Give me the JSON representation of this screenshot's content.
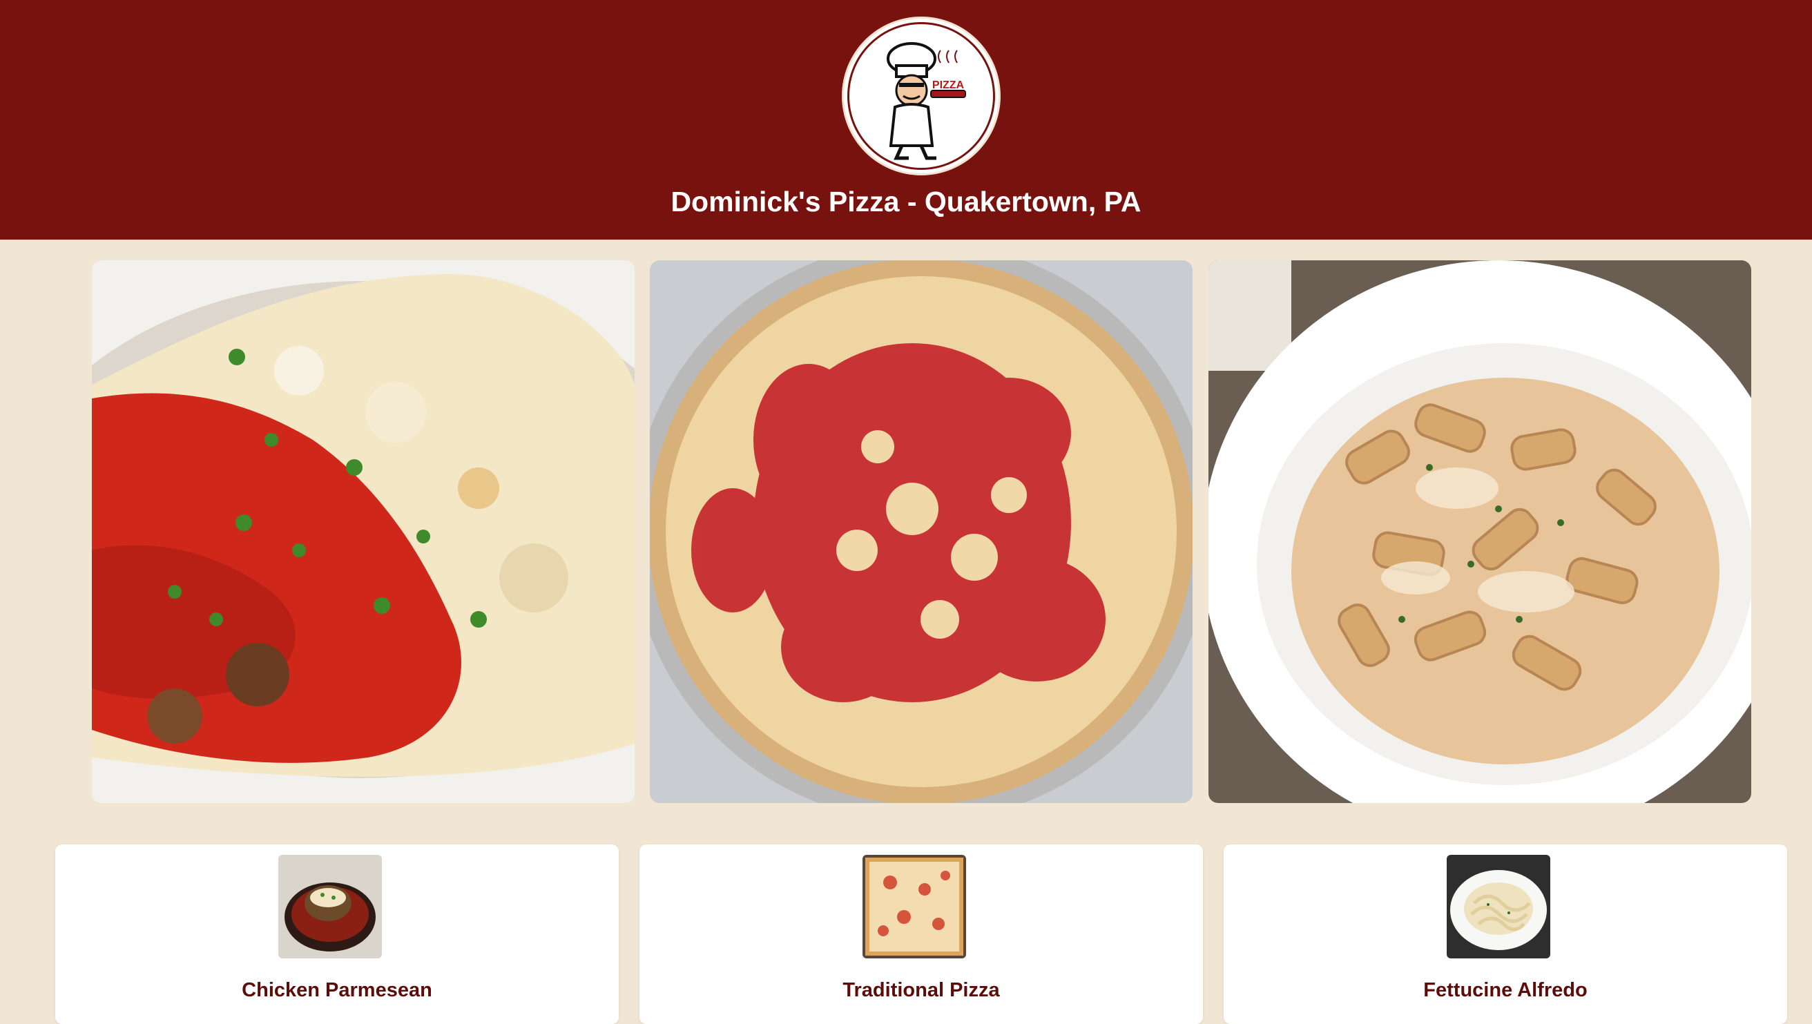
{
  "header": {
    "title": "Dominick's Pizza - Quakertown, PA",
    "logo_icon": "chef-logo-icon",
    "background_color": "#78120e"
  },
  "hero_images": [
    {
      "name": "chicken-parmesean-photo",
      "alt": "Chicken Parmesean"
    },
    {
      "name": "tomato-pie-photo",
      "alt": "Traditional Pizza"
    },
    {
      "name": "rigatoni-photo",
      "alt": "Rigatoni"
    }
  ],
  "menu_cards": [
    {
      "label": "Chicken Parmesean",
      "thumb_icon": "chicken-parmesean-thumb"
    },
    {
      "label": "Traditional Pizza",
      "thumb_icon": "traditional-pizza-thumb"
    },
    {
      "label": "Fettucine Alfredo",
      "thumb_icon": "fettucine-alfredo-thumb"
    }
  ],
  "colors": {
    "page_background": "#f1e6d3",
    "card_background": "#ffffff",
    "label_color": "#5a0d0b"
  }
}
